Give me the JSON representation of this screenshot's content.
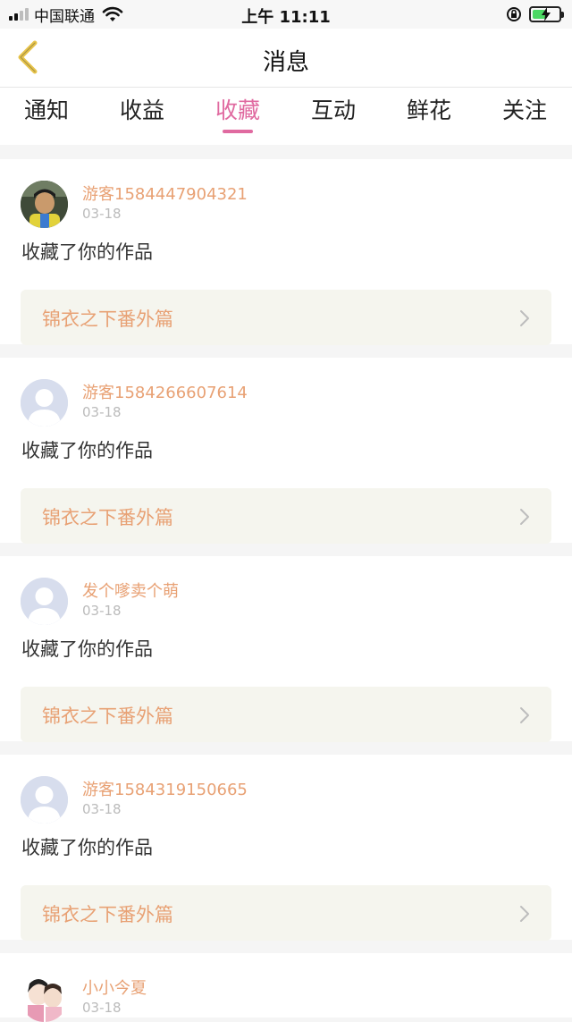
{
  "status_bar": {
    "carrier": "中国联通",
    "time": "上午 11:11"
  },
  "header": {
    "title": "消息"
  },
  "tabs": [
    {
      "label": "通知",
      "active": false
    },
    {
      "label": "收益",
      "active": false
    },
    {
      "label": "收藏",
      "active": true
    },
    {
      "label": "互动",
      "active": false
    },
    {
      "label": "鲜花",
      "active": false
    },
    {
      "label": "关注",
      "active": false
    }
  ],
  "items": [
    {
      "name": "游客1584447904321",
      "date": "03-18",
      "action": "收藏了你的作品",
      "work": "锦衣之下番外篇",
      "avatar": "photo-avatar"
    },
    {
      "name": "游客1584266607614",
      "date": "03-18",
      "action": "收藏了你的作品",
      "work": "锦衣之下番外篇",
      "avatar": "default-avatar"
    },
    {
      "name": "发个嗲卖个萌",
      "date": "03-18",
      "action": "收藏了你的作品",
      "work": "锦衣之下番外篇",
      "avatar": "default-avatar"
    },
    {
      "name": "游客1584319150665",
      "date": "03-18",
      "action": "收藏了你的作品",
      "work": "锦衣之下番外篇",
      "avatar": "default-avatar"
    },
    {
      "name": "小小今夏",
      "date": "03-18",
      "action": "",
      "work": "",
      "avatar": "cartoon-avatar"
    }
  ],
  "colors": {
    "accent_pink": "#e06aa0",
    "name_orange": "#e8a174",
    "back_arrow": "#e7c44a"
  }
}
